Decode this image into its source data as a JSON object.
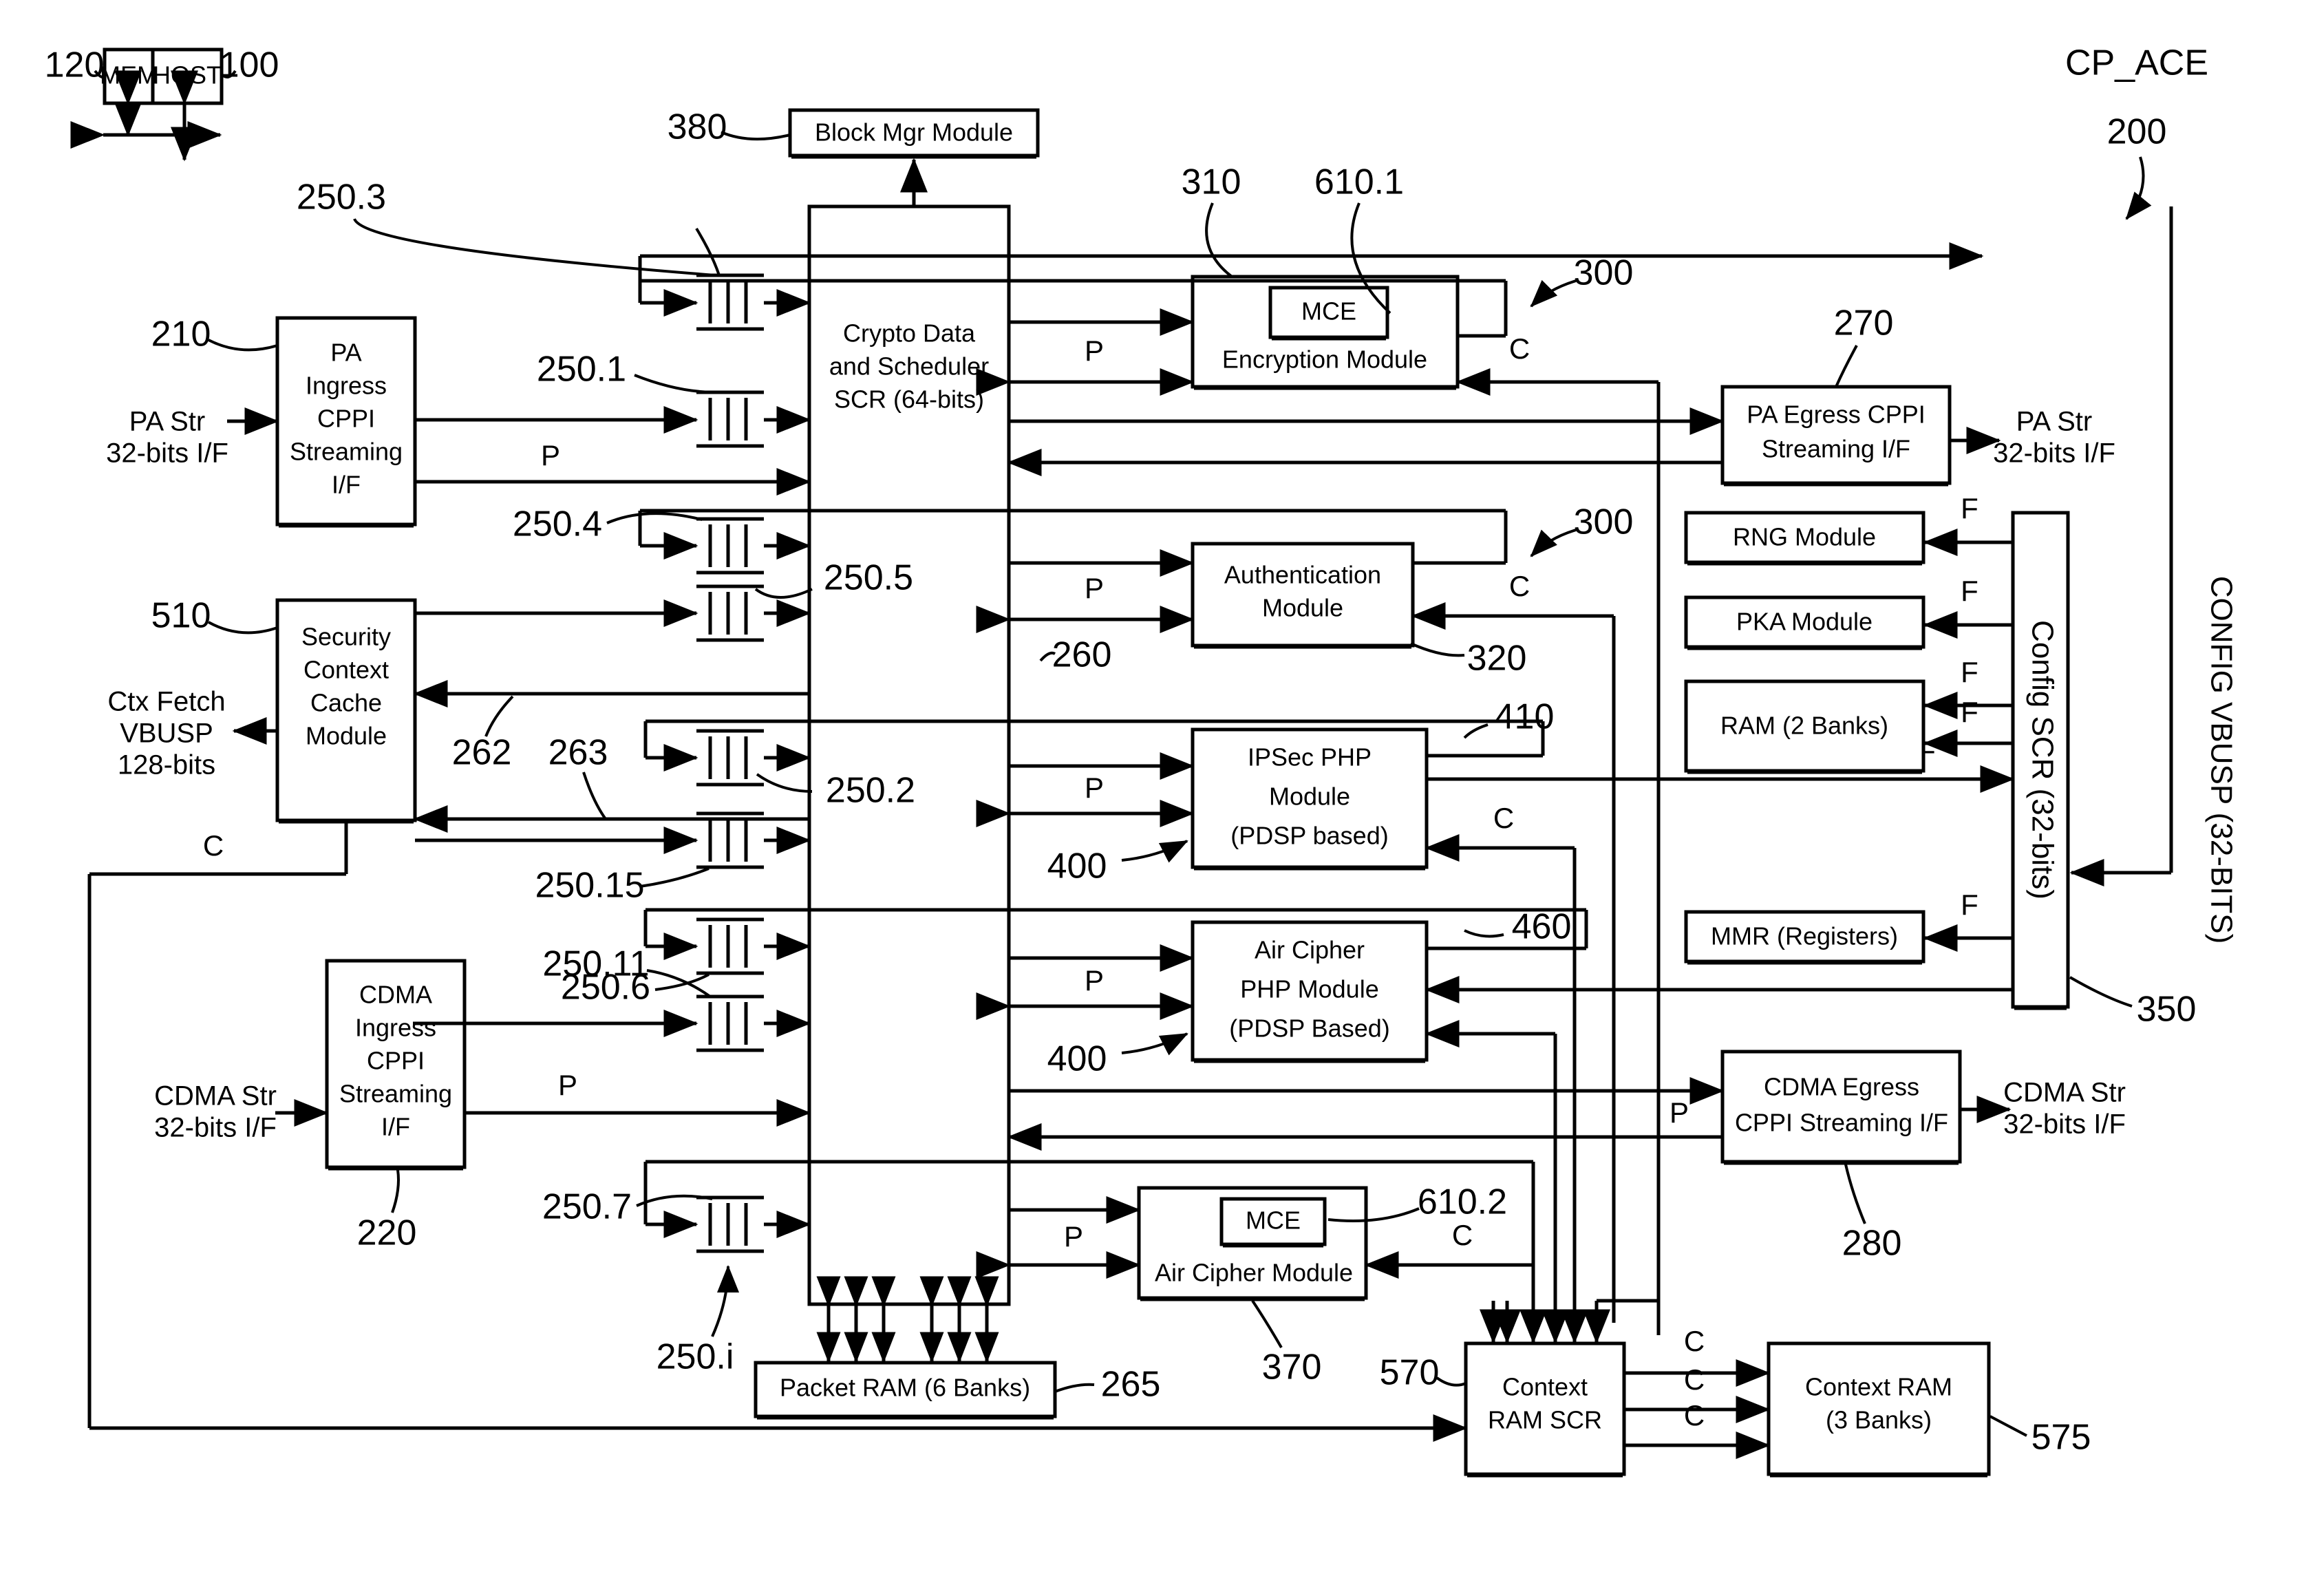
{
  "figure": {
    "title": "CP_ACE",
    "title_ref": "200"
  },
  "blocks": {
    "mem": {
      "label": "MEM",
      "ref": "120"
    },
    "host": {
      "label": "HOST",
      "ref": "100"
    },
    "block_mgr": {
      "label": "Block Mgr Module",
      "ref": "380"
    },
    "crypto_scr": {
      "label_lines": [
        "Crypto Data",
        "and Scheduler",
        "SCR (64-bits)"
      ],
      "ref": ""
    },
    "pa_ingress": {
      "label_lines": [
        "PA",
        "Ingress",
        "CPPI",
        "Streaming",
        "I/F"
      ],
      "ref": "210"
    },
    "sec_ctx_cache": {
      "label_lines": [
        "Security",
        "Context",
        "Cache",
        "Module"
      ],
      "ref": "510"
    },
    "cdma_ingress": {
      "label_lines": [
        "CDMA",
        "Ingress",
        "CPPI",
        "Streaming",
        "I/F"
      ],
      "ref": "220"
    },
    "encryption": {
      "label": "Encryption Module",
      "ref": "310",
      "mce": "MCE",
      "mce_ref": "610.1",
      "group_ref": "300"
    },
    "authentication": {
      "label_lines": [
        "Authentication",
        "Module"
      ],
      "ref": "320",
      "group_ref": "300"
    },
    "ipsec_php": {
      "label_lines": [
        "IPSec PHP",
        "Module",
        "(PDSP based)"
      ],
      "ref": "410",
      "p_ref": "400"
    },
    "air_cipher_php": {
      "label_lines": [
        "Air Cipher",
        "PHP Module",
        "(PDSP Based)"
      ],
      "ref": "460",
      "p_ref": "400"
    },
    "air_cipher_mod": {
      "label": "Air Cipher Module",
      "ref": "370",
      "mce": "MCE",
      "mce_ref": "610.2"
    },
    "pa_egress": {
      "label_lines": [
        "PA Egress CPPI",
        "Streaming I/F"
      ],
      "ref": "270"
    },
    "cdma_egress": {
      "label_lines": [
        "CDMA Egress",
        "CPPI Streaming I/F"
      ],
      "ref": "280"
    },
    "rng": {
      "label": "RNG Module",
      "ref": ""
    },
    "pka": {
      "label": "PKA Module",
      "ref": ""
    },
    "ram2": {
      "label": "RAM (2 Banks)",
      "ref": ""
    },
    "mmr": {
      "label": "MMR (Registers)",
      "ref": ""
    },
    "config_scr": {
      "label": "Config SCR (32-bits)",
      "ref": "350"
    },
    "config_vbusp": {
      "label": "CONFIG VBUSP (32-BITS)"
    },
    "packet_ram": {
      "label": "Packet RAM (6 Banks)",
      "ref": "265"
    },
    "context_ram_scr": {
      "label_lines": [
        "Context",
        "RAM SCR"
      ],
      "ref": "570"
    },
    "context_ram": {
      "label_lines": [
        "Context RAM",
        "(3 Banks)"
      ],
      "ref": "575"
    }
  },
  "io_labels": {
    "pa_str_in": [
      "PA Str",
      "32-bits I/F"
    ],
    "pa_str_out": [
      "PA Str",
      "32-bits I/F"
    ],
    "cdma_str_in": [
      "CDMA Str",
      "32-bits I/F"
    ],
    "cdma_str_out": [
      "CDMA Str",
      "32-bits I/F"
    ],
    "ctx_fetch": [
      "Ctx Fetch",
      "VBUSP",
      "128-bits"
    ]
  },
  "fifo_refs": [
    "250.3",
    "250.1",
    "250.4",
    "250.5",
    "250.2",
    "250.15",
    "250.6",
    "250.11",
    "250.7",
    "250.i"
  ],
  "bus_refs": {
    "auth_bus": "260",
    "sec_bus_a": "262",
    "sec_bus_b": "263"
  },
  "signal_letters": {
    "p": "P",
    "c": "C",
    "f": "F"
  }
}
